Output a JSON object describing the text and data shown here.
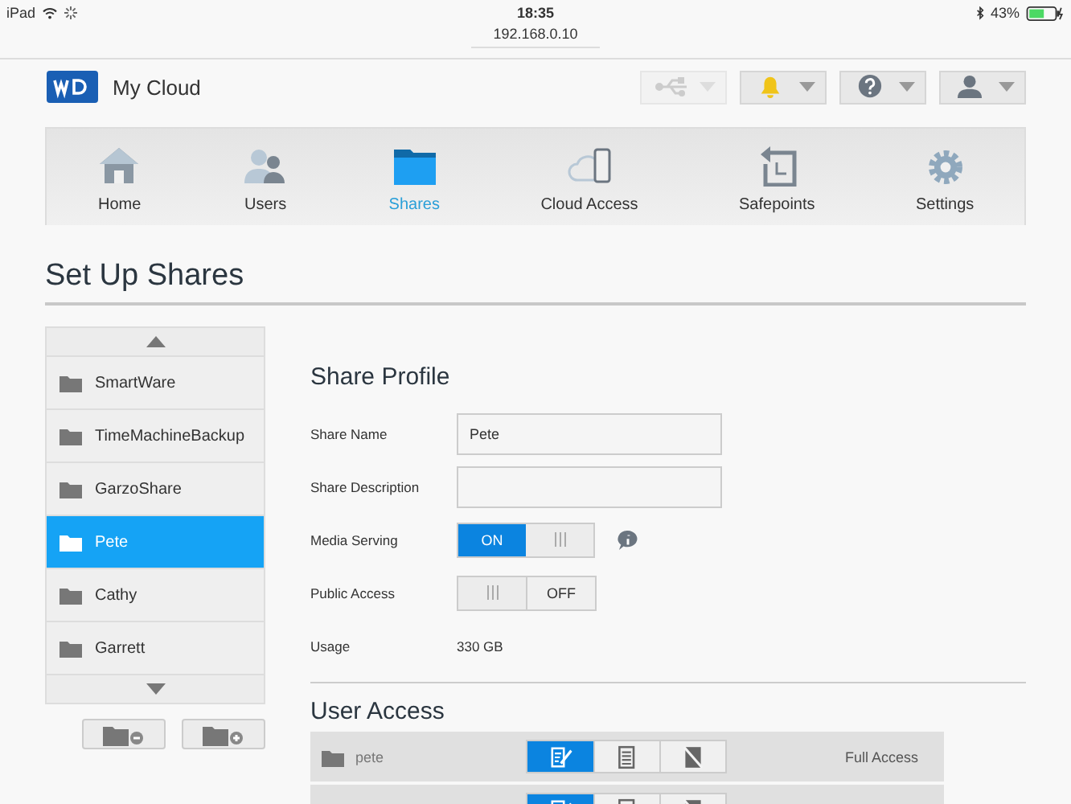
{
  "status_bar": {
    "device": "iPad",
    "time": "18:35",
    "battery": "43%",
    "url": "192.168.0.10"
  },
  "header": {
    "brand": "My Cloud",
    "buttons": [
      {
        "kind": "usb",
        "disabled": true
      },
      {
        "kind": "bell",
        "disabled": false
      },
      {
        "kind": "help",
        "disabled": false
      },
      {
        "kind": "user",
        "disabled": false
      }
    ]
  },
  "nav": [
    {
      "label": "Home",
      "selected": false
    },
    {
      "label": "Users",
      "selected": false
    },
    {
      "label": "Shares",
      "selected": true
    },
    {
      "label": "Cloud Access",
      "selected": false
    },
    {
      "label": "Safepoints",
      "selected": false
    },
    {
      "label": "Settings",
      "selected": false
    }
  ],
  "page_title": "Set Up Shares",
  "shares": [
    {
      "name": "SmartWare",
      "selected": false
    },
    {
      "name": "TimeMachineBackup",
      "selected": false
    },
    {
      "name": "GarzoShare",
      "selected": false
    },
    {
      "name": "Pete",
      "selected": true
    },
    {
      "name": "Cathy",
      "selected": false
    },
    {
      "name": "Garrett",
      "selected": false
    }
  ],
  "profile": {
    "title": "Share Profile",
    "fields": [
      {
        "kind": "text",
        "label": "Share Name",
        "value": "Pete"
      },
      {
        "kind": "text",
        "label": "Share Description"
      },
      {
        "kind": "toggle",
        "label": "Media Serving",
        "on": true,
        "on_text": "ON",
        "info": true
      },
      {
        "kind": "toggle",
        "label": "Public Access",
        "on": false,
        "off_text": "OFF",
        "info": false
      },
      {
        "kind": "static",
        "label": "Usage",
        "value": "330 GB"
      }
    ]
  },
  "user_access": {
    "title": "User Access",
    "rows": [
      {
        "user": "pete",
        "access": "Full Access",
        "levels": [
          {
            "selected": true
          },
          {
            "selected": false
          },
          {
            "selected": false
          }
        ]
      },
      {
        "levels": [
          {
            "selected": true
          },
          {
            "selected": false
          },
          {
            "selected": false
          }
        ]
      }
    ]
  }
}
